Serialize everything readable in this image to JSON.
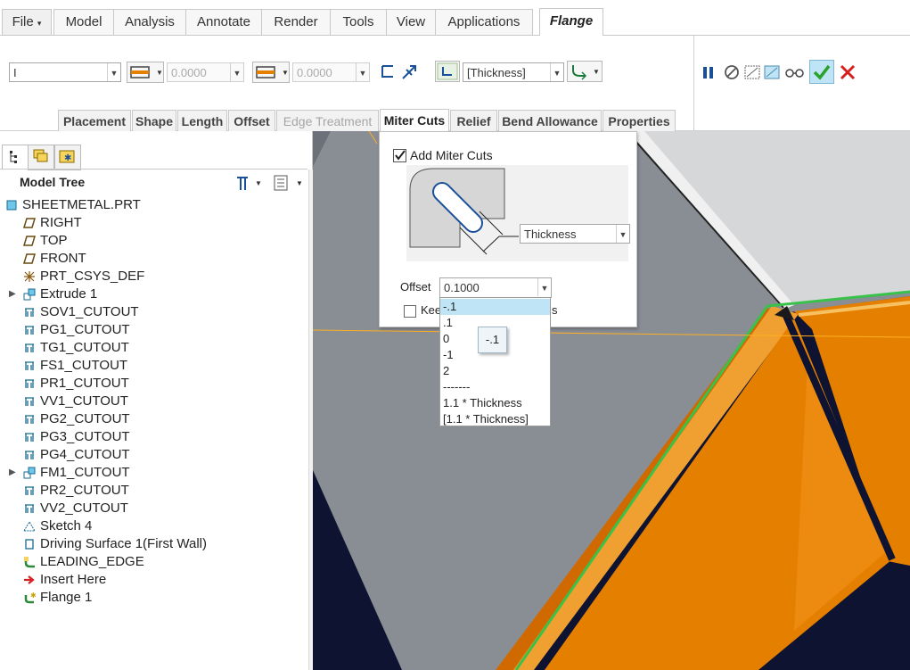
{
  "ribbon": {
    "tabs": [
      "File",
      "Model",
      "Analysis",
      "Annotate",
      "Render",
      "Tools",
      "View",
      "Applications",
      "Flange"
    ],
    "active_tab": "Flange"
  },
  "toolbar": {
    "shape_combo": "I",
    "length1_value": "0.0000",
    "length2_value": "0.0000",
    "thickness_combo": "[Thickness]"
  },
  "subtabs": [
    "Placement",
    "Shape",
    "Length",
    "Offset",
    "Edge Treatment",
    "Miter Cuts",
    "Relief",
    "Bend Allowance",
    "Properties"
  ],
  "subtabs_state": {
    "active": "Miter Cuts",
    "disabled": "Edge Treatment"
  },
  "sidebar": {
    "title": "Model Tree",
    "items": [
      {
        "label": "SHEETMETAL.PRT",
        "icon": "part-icon",
        "expandable": false,
        "level": 0
      },
      {
        "label": "RIGHT",
        "icon": "datum-plane-icon",
        "expandable": false,
        "level": 1
      },
      {
        "label": "TOP",
        "icon": "datum-plane-icon",
        "expandable": false,
        "level": 1
      },
      {
        "label": "FRONT",
        "icon": "datum-plane-icon",
        "expandable": false,
        "level": 1
      },
      {
        "label": "PRT_CSYS_DEF",
        "icon": "csys-icon",
        "expandable": false,
        "level": 1
      },
      {
        "label": "Extrude 1",
        "icon": "extrude-icon",
        "expandable": true,
        "level": 1
      },
      {
        "label": "SOV1_CUTOUT",
        "icon": "cutout-icon",
        "expandable": false,
        "level": 1
      },
      {
        "label": "PG1_CUTOUT",
        "icon": "cutout-icon",
        "expandable": false,
        "level": 1
      },
      {
        "label": "TG1_CUTOUT",
        "icon": "cutout-icon",
        "expandable": false,
        "level": 1
      },
      {
        "label": "FS1_CUTOUT",
        "icon": "cutout-icon",
        "expandable": false,
        "level": 1
      },
      {
        "label": "PR1_CUTOUT",
        "icon": "cutout-icon",
        "expandable": false,
        "level": 1
      },
      {
        "label": "VV1_CUTOUT",
        "icon": "cutout-icon",
        "expandable": false,
        "level": 1
      },
      {
        "label": "PG2_CUTOUT",
        "icon": "cutout-icon",
        "expandable": false,
        "level": 1
      },
      {
        "label": "PG3_CUTOUT",
        "icon": "cutout-icon",
        "expandable": false,
        "level": 1
      },
      {
        "label": "PG4_CUTOUT",
        "icon": "cutout-icon",
        "expandable": false,
        "level": 1
      },
      {
        "label": "FM1_CUTOUT",
        "icon": "extrude-icon",
        "expandable": true,
        "level": 1
      },
      {
        "label": "PR2_CUTOUT",
        "icon": "cutout-icon",
        "expandable": false,
        "level": 1
      },
      {
        "label": "VV2_CUTOUT",
        "icon": "cutout-icon",
        "expandable": false,
        "level": 1
      },
      {
        "label": "Sketch 4",
        "icon": "sketch-icon",
        "expandable": false,
        "level": 1
      },
      {
        "label": "Driving Surface 1(First Wall)",
        "icon": "wall-icon",
        "expandable": false,
        "level": 1
      },
      {
        "label": "LEADING_EDGE",
        "icon": "flange-icon",
        "expandable": false,
        "level": 1
      },
      {
        "label": "Insert Here",
        "icon": "insert-arrow-icon",
        "expandable": false,
        "level": 1
      },
      {
        "label": "Flange 1",
        "icon": "flange-new-icon",
        "expandable": false,
        "level": 1
      }
    ]
  },
  "miter_panel": {
    "add_miter_cuts_label": "Add Miter Cuts",
    "add_miter_cuts_checked": true,
    "width_combo": "Thickness",
    "offset_label": "Offset",
    "offset_value": "0.1000",
    "keep_checkbox_label_start": "Kee",
    "keep_checkbox_label_end": "s"
  },
  "offset_dropdown": {
    "options": [
      "-.1",
      ".1",
      "0",
      "-1",
      "2",
      "-------",
      "1.1 * Thickness",
      "[1.1 * Thickness]"
    ],
    "selected": "-.1"
  },
  "tooltip": {
    "text": "-.1"
  },
  "colors": {
    "accent_orange": "#e57f00",
    "edge_green": "#39c24a",
    "viewport_gray": "#8b8f96",
    "dark_navy": "#0e1331",
    "selection_blue": "#bfe4f6"
  }
}
